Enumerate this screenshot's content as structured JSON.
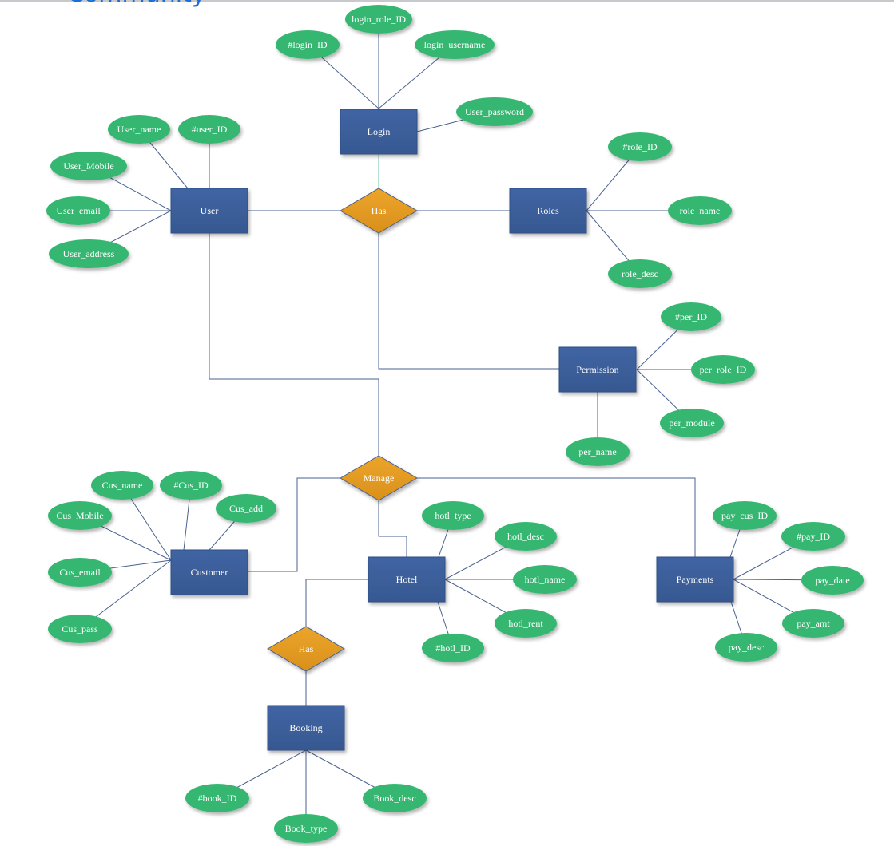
{
  "header": {
    "partial_text": "Community"
  },
  "colors": {
    "entity": "#3b5c9a",
    "relationship": "#e49e24",
    "attribute": "#35b771",
    "line": "#4a6290",
    "label": "#ffffff"
  },
  "entities": [
    {
      "id": "login",
      "label": "Login"
    },
    {
      "id": "user",
      "label": "User"
    },
    {
      "id": "roles",
      "label": "Roles"
    },
    {
      "id": "permission",
      "label": "Permission"
    },
    {
      "id": "customer",
      "label": "Customer"
    },
    {
      "id": "hotel",
      "label": "Hotel"
    },
    {
      "id": "payments",
      "label": "Payments"
    },
    {
      "id": "booking",
      "label": "Booking"
    }
  ],
  "relationships": [
    {
      "id": "has1",
      "label": "Has"
    },
    {
      "id": "manage",
      "label": "Manage"
    },
    {
      "id": "has2",
      "label": "Has"
    }
  ],
  "attributes": [
    {
      "id": "login_ID",
      "label": "#login_ID",
      "entity": "login"
    },
    {
      "id": "login_role_ID",
      "label": "login_role_ID",
      "entity": "login"
    },
    {
      "id": "login_username",
      "label": "login_username",
      "entity": "login"
    },
    {
      "id": "User_password",
      "label": "User_password",
      "entity": "login"
    },
    {
      "id": "User_name",
      "label": "User_name",
      "entity": "user"
    },
    {
      "id": "user_ID",
      "label": "#user_ID",
      "entity": "user"
    },
    {
      "id": "User_Mobile",
      "label": "User_Mobile",
      "entity": "user"
    },
    {
      "id": "User_email",
      "label": "User_email",
      "entity": "user"
    },
    {
      "id": "User_address",
      "label": "User_address",
      "entity": "user"
    },
    {
      "id": "role_ID",
      "label": "#role_ID",
      "entity": "roles"
    },
    {
      "id": "role_name",
      "label": "role_name",
      "entity": "roles"
    },
    {
      "id": "role_desc",
      "label": "role_desc",
      "entity": "roles"
    },
    {
      "id": "per_ID",
      "label": "#per_ID",
      "entity": "permission"
    },
    {
      "id": "per_role_ID",
      "label": "per_role_ID",
      "entity": "permission"
    },
    {
      "id": "per_module",
      "label": "per_module",
      "entity": "permission"
    },
    {
      "id": "per_name",
      "label": "per_name",
      "entity": "permission"
    },
    {
      "id": "Cus_name",
      "label": "Cus_name",
      "entity": "customer"
    },
    {
      "id": "Cus_ID",
      "label": "#Cus_ID",
      "entity": "customer"
    },
    {
      "id": "Cus_add",
      "label": "Cus_add",
      "entity": "customer"
    },
    {
      "id": "Cus_Mobile",
      "label": "Cus_Mobile",
      "entity": "customer"
    },
    {
      "id": "Cus_email",
      "label": "Cus_email",
      "entity": "customer"
    },
    {
      "id": "Cus_pass",
      "label": "Cus_pass",
      "entity": "customer"
    },
    {
      "id": "hotl_type",
      "label": "hotl_type",
      "entity": "hotel"
    },
    {
      "id": "hotl_desc",
      "label": "hotl_desc",
      "entity": "hotel"
    },
    {
      "id": "hotl_name",
      "label": "hotl_name",
      "entity": "hotel"
    },
    {
      "id": "hotl_rent",
      "label": "hotl_rent",
      "entity": "hotel"
    },
    {
      "id": "hotl_ID",
      "label": "#hotl_ID",
      "entity": "hotel"
    },
    {
      "id": "pay_cus_ID",
      "label": "pay_cus_ID",
      "entity": "payments"
    },
    {
      "id": "pay_ID",
      "label": "#pay_ID",
      "entity": "payments"
    },
    {
      "id": "pay_date",
      "label": "pay_date",
      "entity": "payments"
    },
    {
      "id": "pay_amt",
      "label": "pay_amt",
      "entity": "payments"
    },
    {
      "id": "pay_desc",
      "label": "pay_desc",
      "entity": "payments"
    },
    {
      "id": "book_ID",
      "label": "#book_ID",
      "entity": "booking"
    },
    {
      "id": "Book_type",
      "label": "Book_type",
      "entity": "booking"
    },
    {
      "id": "Book_desc",
      "label": "Book_desc",
      "entity": "booking"
    }
  ],
  "relationship_links": [
    {
      "relationship": "has1",
      "entities": [
        "login",
        "user",
        "roles",
        "permission"
      ]
    },
    {
      "relationship": "manage",
      "entities": [
        "user",
        "customer",
        "hotel",
        "payments"
      ]
    },
    {
      "relationship": "has2",
      "entities": [
        "hotel",
        "booking"
      ]
    }
  ]
}
